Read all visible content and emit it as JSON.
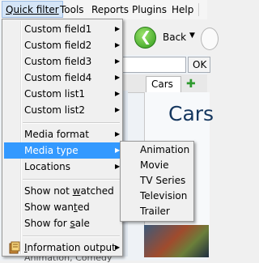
{
  "menubar": {
    "quick_filter": "Quick filter",
    "tools": "Tools",
    "reports": "Reports",
    "plugins": "Plugins",
    "help": "Help"
  },
  "toolbar": {
    "back": "Back"
  },
  "search": {
    "ok": "OK"
  },
  "tabs": {
    "cars": "Cars"
  },
  "content": {
    "title": "Cars"
  },
  "quick_filter_menu": {
    "items": [
      {
        "label": "Custom field1"
      },
      {
        "label": "Custom field2"
      },
      {
        "label": "Custom field3"
      },
      {
        "label": "Custom field4"
      },
      {
        "label": "Custom list1"
      },
      {
        "label": "Custom list2"
      },
      {
        "label": "Media format"
      },
      {
        "label": "Media type"
      },
      {
        "label": "Locations"
      },
      {
        "label": "Show not watched"
      },
      {
        "label": "Show wanted"
      },
      {
        "label": "Show for sale"
      },
      {
        "label": "Information output"
      }
    ]
  },
  "media_type_submenu": {
    "items": [
      "Animation",
      "Movie",
      "TV Series",
      "Television",
      "Trailer"
    ]
  },
  "footer": {
    "text": "Animation, Comedy"
  },
  "colors": {
    "highlight": "#3399ff",
    "menu_bg": "#f0f0f0"
  }
}
